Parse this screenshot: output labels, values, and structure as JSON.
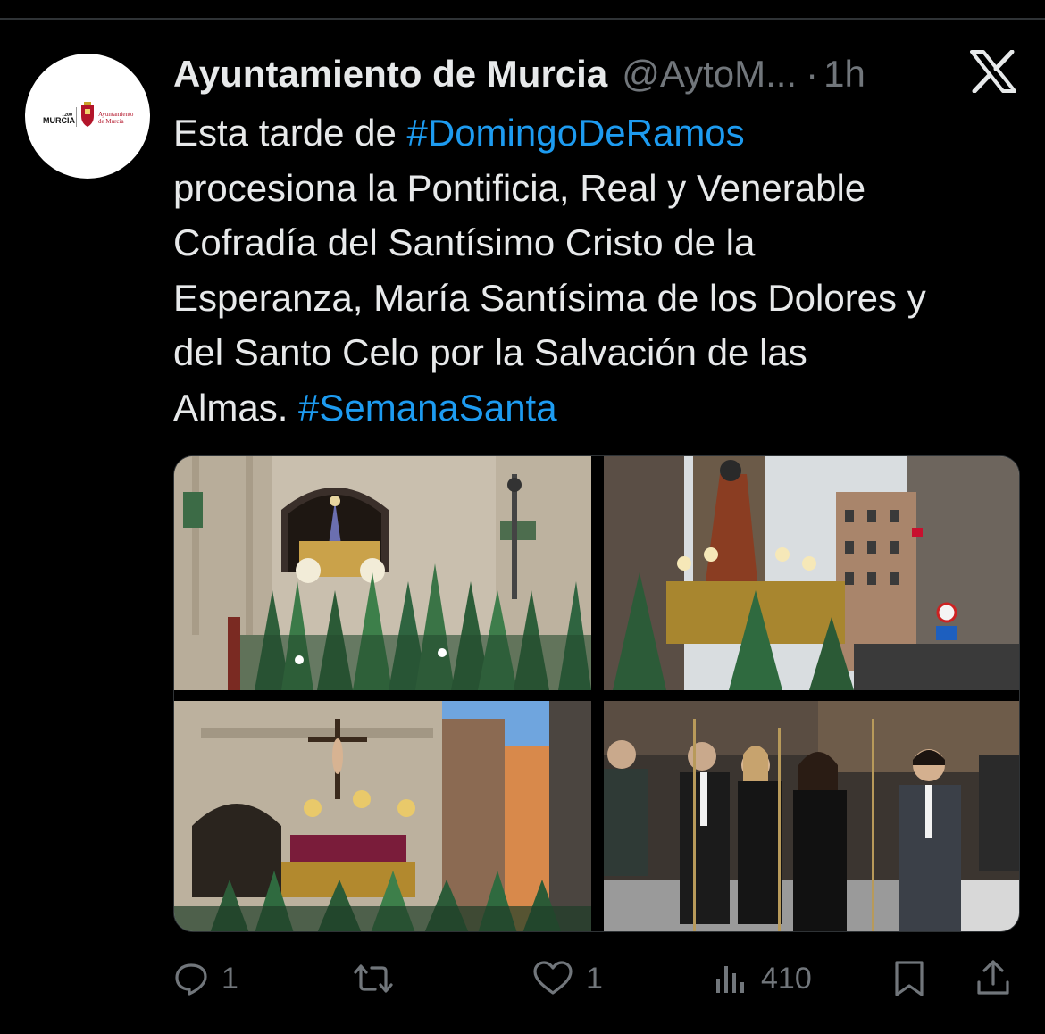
{
  "colors": {
    "background": "#000000",
    "text": "#e7e9ea",
    "muted": "#71767b",
    "link": "#1d9bf0",
    "divider": "#2f3336"
  },
  "avatar": {
    "logo_text": "MURCIA",
    "logo_year": "1200",
    "logo_caption_1": "Ayuntamiento",
    "logo_caption_2": "de Murcia"
  },
  "header": {
    "display_name": "Ayuntamiento de Murcia",
    "handle": "@AytoM...",
    "separator": "·",
    "time": "1h",
    "platform_icon": "x-logo-icon"
  },
  "tweet": {
    "line1_text": "Esta tarde de ",
    "hashtag1": "#DomingoDeRamos",
    "line2": "procesiona la Pontificia, Real y Venerable",
    "line3": "Cofradía del Santísimo Cristo de la",
    "line4": "Esperanza, María Santísima de los Dolores y",
    "line5": "del Santo Celo por la Salvación de las",
    "line6_text": "Almas. ",
    "hashtag2": "#SemanaSanta"
  },
  "media": {
    "photos": [
      {
        "subject": "procession-church-facade"
      },
      {
        "subject": "procession-street-float"
      },
      {
        "subject": "crucifix-float-church"
      },
      {
        "subject": "officials-with-staffs"
      }
    ]
  },
  "actions": {
    "reply": {
      "icon": "reply-icon",
      "count": "1"
    },
    "retweet": {
      "icon": "retweet-icon",
      "count": ""
    },
    "like": {
      "icon": "heart-icon",
      "count": "1"
    },
    "views": {
      "icon": "views-icon",
      "count": "410"
    },
    "bookmark": {
      "icon": "bookmark-icon"
    },
    "share": {
      "icon": "share-icon"
    }
  }
}
